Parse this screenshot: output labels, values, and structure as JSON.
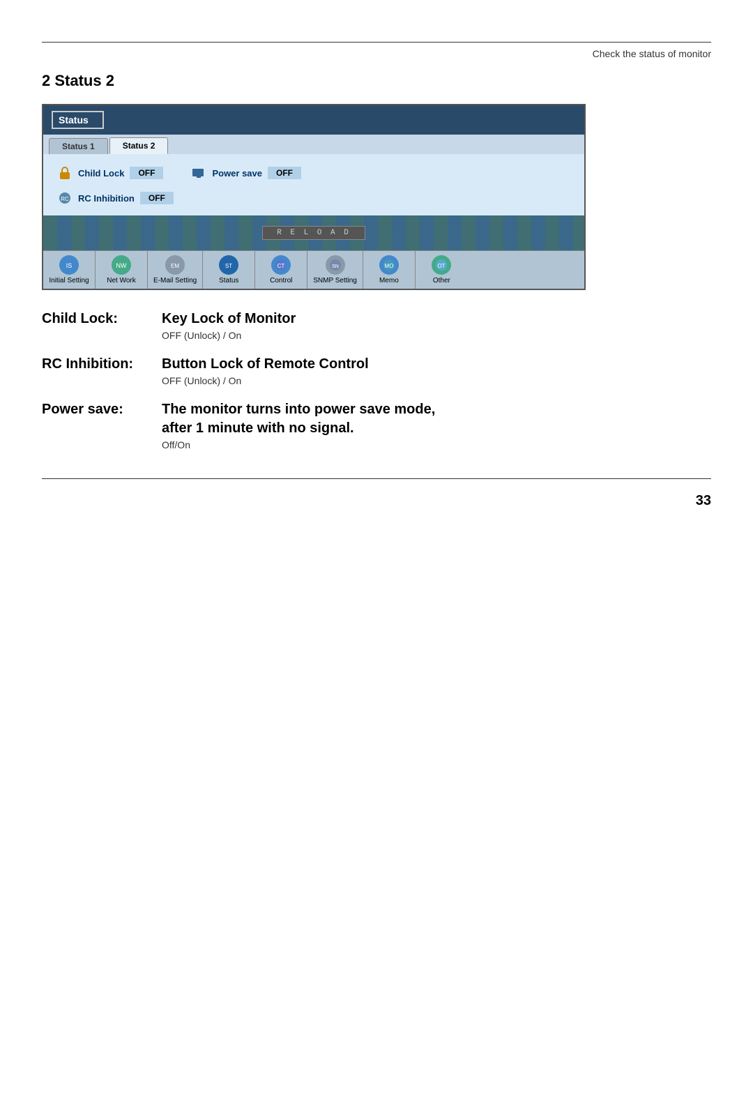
{
  "header": {
    "rule_visible": true,
    "subtitle": "Check the status of monitor"
  },
  "section": {
    "heading": "2 Status 2"
  },
  "monitor_ui": {
    "title": "Status",
    "tabs": [
      {
        "label": "Status 1",
        "active": false
      },
      {
        "label": "Status 2",
        "active": true
      }
    ],
    "status_items": [
      {
        "label": "Child Lock",
        "value": "OFF",
        "icon": "🔒"
      },
      {
        "label": "Power save",
        "value": "OFF",
        "icon": "🖥"
      }
    ],
    "rc_inhibition": {
      "label": "RC Inhibition",
      "value": "OFF",
      "icon": "🔧"
    },
    "reload_button": "R E L O A D"
  },
  "nav_items": [
    {
      "label": "Initial Setting",
      "icon": "🌐",
      "color": "nav-icon-blue"
    },
    {
      "label": "Net Work",
      "icon": "🌐",
      "color": "nav-icon-green"
    },
    {
      "label": "E-Mail Setting",
      "icon": "✉",
      "color": "nav-icon-gray"
    },
    {
      "label": "Status",
      "icon": "📊",
      "color": "nav-icon-active"
    },
    {
      "label": "Control",
      "icon": "🎮",
      "color": "nav-icon-blue"
    },
    {
      "label": "SNMP Setting",
      "icon": "⚙",
      "color": "nav-icon-gray"
    },
    {
      "label": "Memo",
      "icon": "📝",
      "color": "nav-icon-blue"
    },
    {
      "label": "Other",
      "icon": "🔄",
      "color": "nav-icon-green"
    }
  ],
  "entries": [
    {
      "key": "Child Lock:",
      "title": "Key Lock of Monitor",
      "description": "OFF (Unlock) / On"
    },
    {
      "key": "RC Inhibition:",
      "title": "Button Lock of Remote Control",
      "description": "OFF (Unlock) / On"
    },
    {
      "key": "Power save:",
      "title_line1": "The monitor  turns into power save mode,",
      "title_line2": "after 1 minute with no signal.",
      "description": "Off/On"
    }
  ],
  "page_number": "33"
}
